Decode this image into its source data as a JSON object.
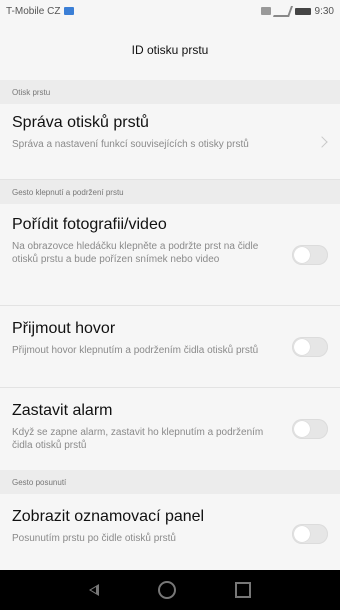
{
  "status": {
    "carrier": "T-Mobile CZ",
    "time": "9:30"
  },
  "header": {
    "title": "ID otisku prstu"
  },
  "sections": [
    {
      "label": "Otisk prstu",
      "rows": [
        {
          "title": "Správa otisků prstů",
          "subtitle": "Správa a nastavení funkcí souvisejících s otisky prstů",
          "control": "chevron"
        }
      ]
    },
    {
      "label": "Gesto klepnutí a podržení prstu",
      "rows": [
        {
          "title": "Pořídit fotografii/video",
          "subtitle": "Na obrazovce hledáčku klepněte a podržte prst na čidle otisků prstu a bude pořízen snímek nebo video",
          "control": "toggle",
          "on": false
        },
        {
          "title": "Přijmout hovor",
          "subtitle": "Přijmout hovor klepnutím a podržením čidla otisků prstů",
          "control": "toggle",
          "on": false
        },
        {
          "title": "Zastavit alarm",
          "subtitle": "Když se zapne alarm, zastavit ho klepnutím a podržením čidla otisků prstů",
          "control": "toggle",
          "on": false
        }
      ]
    },
    {
      "label": "Gesto posunutí",
      "rows": [
        {
          "title": "Zobrazit oznamovací panel",
          "subtitle": "Posunutím prstu po čidle otisků prstů",
          "control": "toggle",
          "on": false
        }
      ]
    }
  ],
  "colors": {
    "background": "#f6f6f6",
    "section_bg": "#ececec",
    "navbar": "#000000"
  }
}
